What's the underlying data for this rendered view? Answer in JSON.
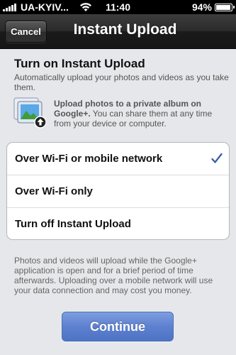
{
  "status_bar": {
    "carrier": "UA-KYIV...",
    "time": "11:40",
    "battery": "94%",
    "signal_icon": "signal-bars-icon",
    "wifi_icon": "wifi-icon",
    "battery_icon": "battery-icon"
  },
  "nav": {
    "cancel_label": "Cancel",
    "title": "Instant Upload"
  },
  "intro": {
    "title": "Turn on Instant Upload",
    "description": "Automatically upload your photos and videos as you take them."
  },
  "info": {
    "icon": "photo-upload-icon",
    "bold_text": "Upload photos to a private album on Google+.",
    "text": " You can share them at any time from your device or computer."
  },
  "options": [
    {
      "label": "Over Wi-Fi or mobile network",
      "selected": true
    },
    {
      "label": "Over Wi-Fi only",
      "selected": false
    },
    {
      "label": "Turn off Instant Upload",
      "selected": false
    }
  ],
  "footer_note": "Photos and videos will upload while the Google+ application is open and for a brief period of time afterwards. Uploading over a mobile network will use your data connection and may cost you money.",
  "continue_label": "Continue",
  "colors": {
    "accent": "#3a5fa8",
    "button": "#5d80cf"
  }
}
